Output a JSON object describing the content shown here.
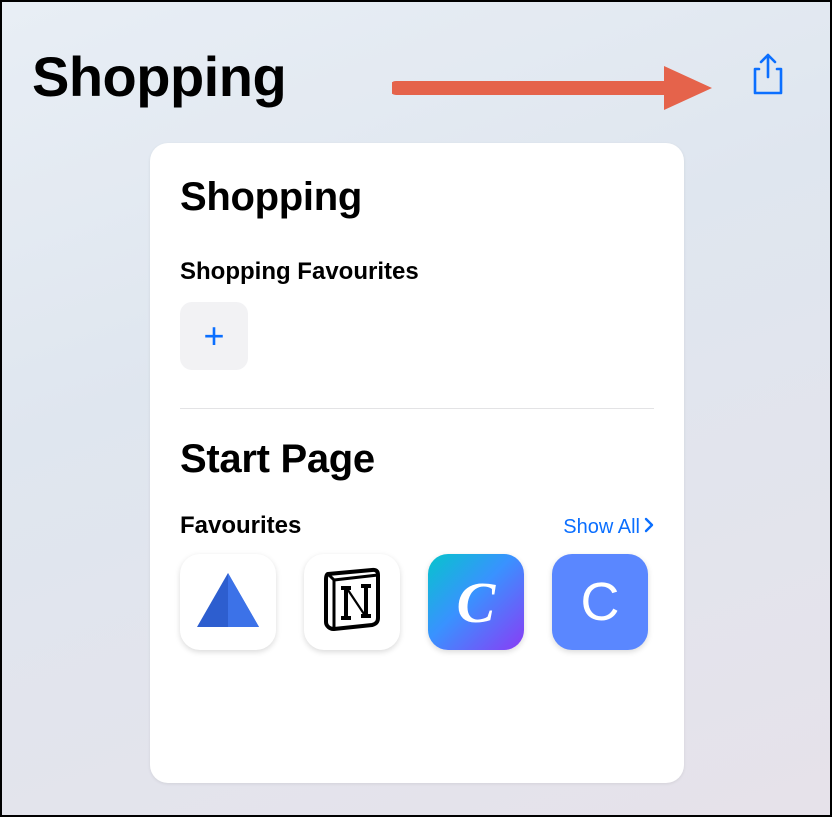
{
  "header": {
    "title": "Shopping"
  },
  "card": {
    "section1": {
      "title": "Shopping",
      "sub_title": "Shopping Favourites"
    },
    "section2": {
      "title": "Start Page",
      "sub_title": "Favourites",
      "show_all": "Show All",
      "tiles": [
        {
          "name": "autodesk-tile"
        },
        {
          "name": "notion-tile"
        },
        {
          "name": "canva-tile",
          "glyph": "C"
        },
        {
          "name": "c-tile",
          "glyph": "C"
        }
      ]
    }
  },
  "icons": {
    "share": "share-icon",
    "plus": "+",
    "chevron": "chevron-right-icon"
  },
  "colors": {
    "accent": "#0b6fff",
    "arrow": "#e5634b"
  }
}
